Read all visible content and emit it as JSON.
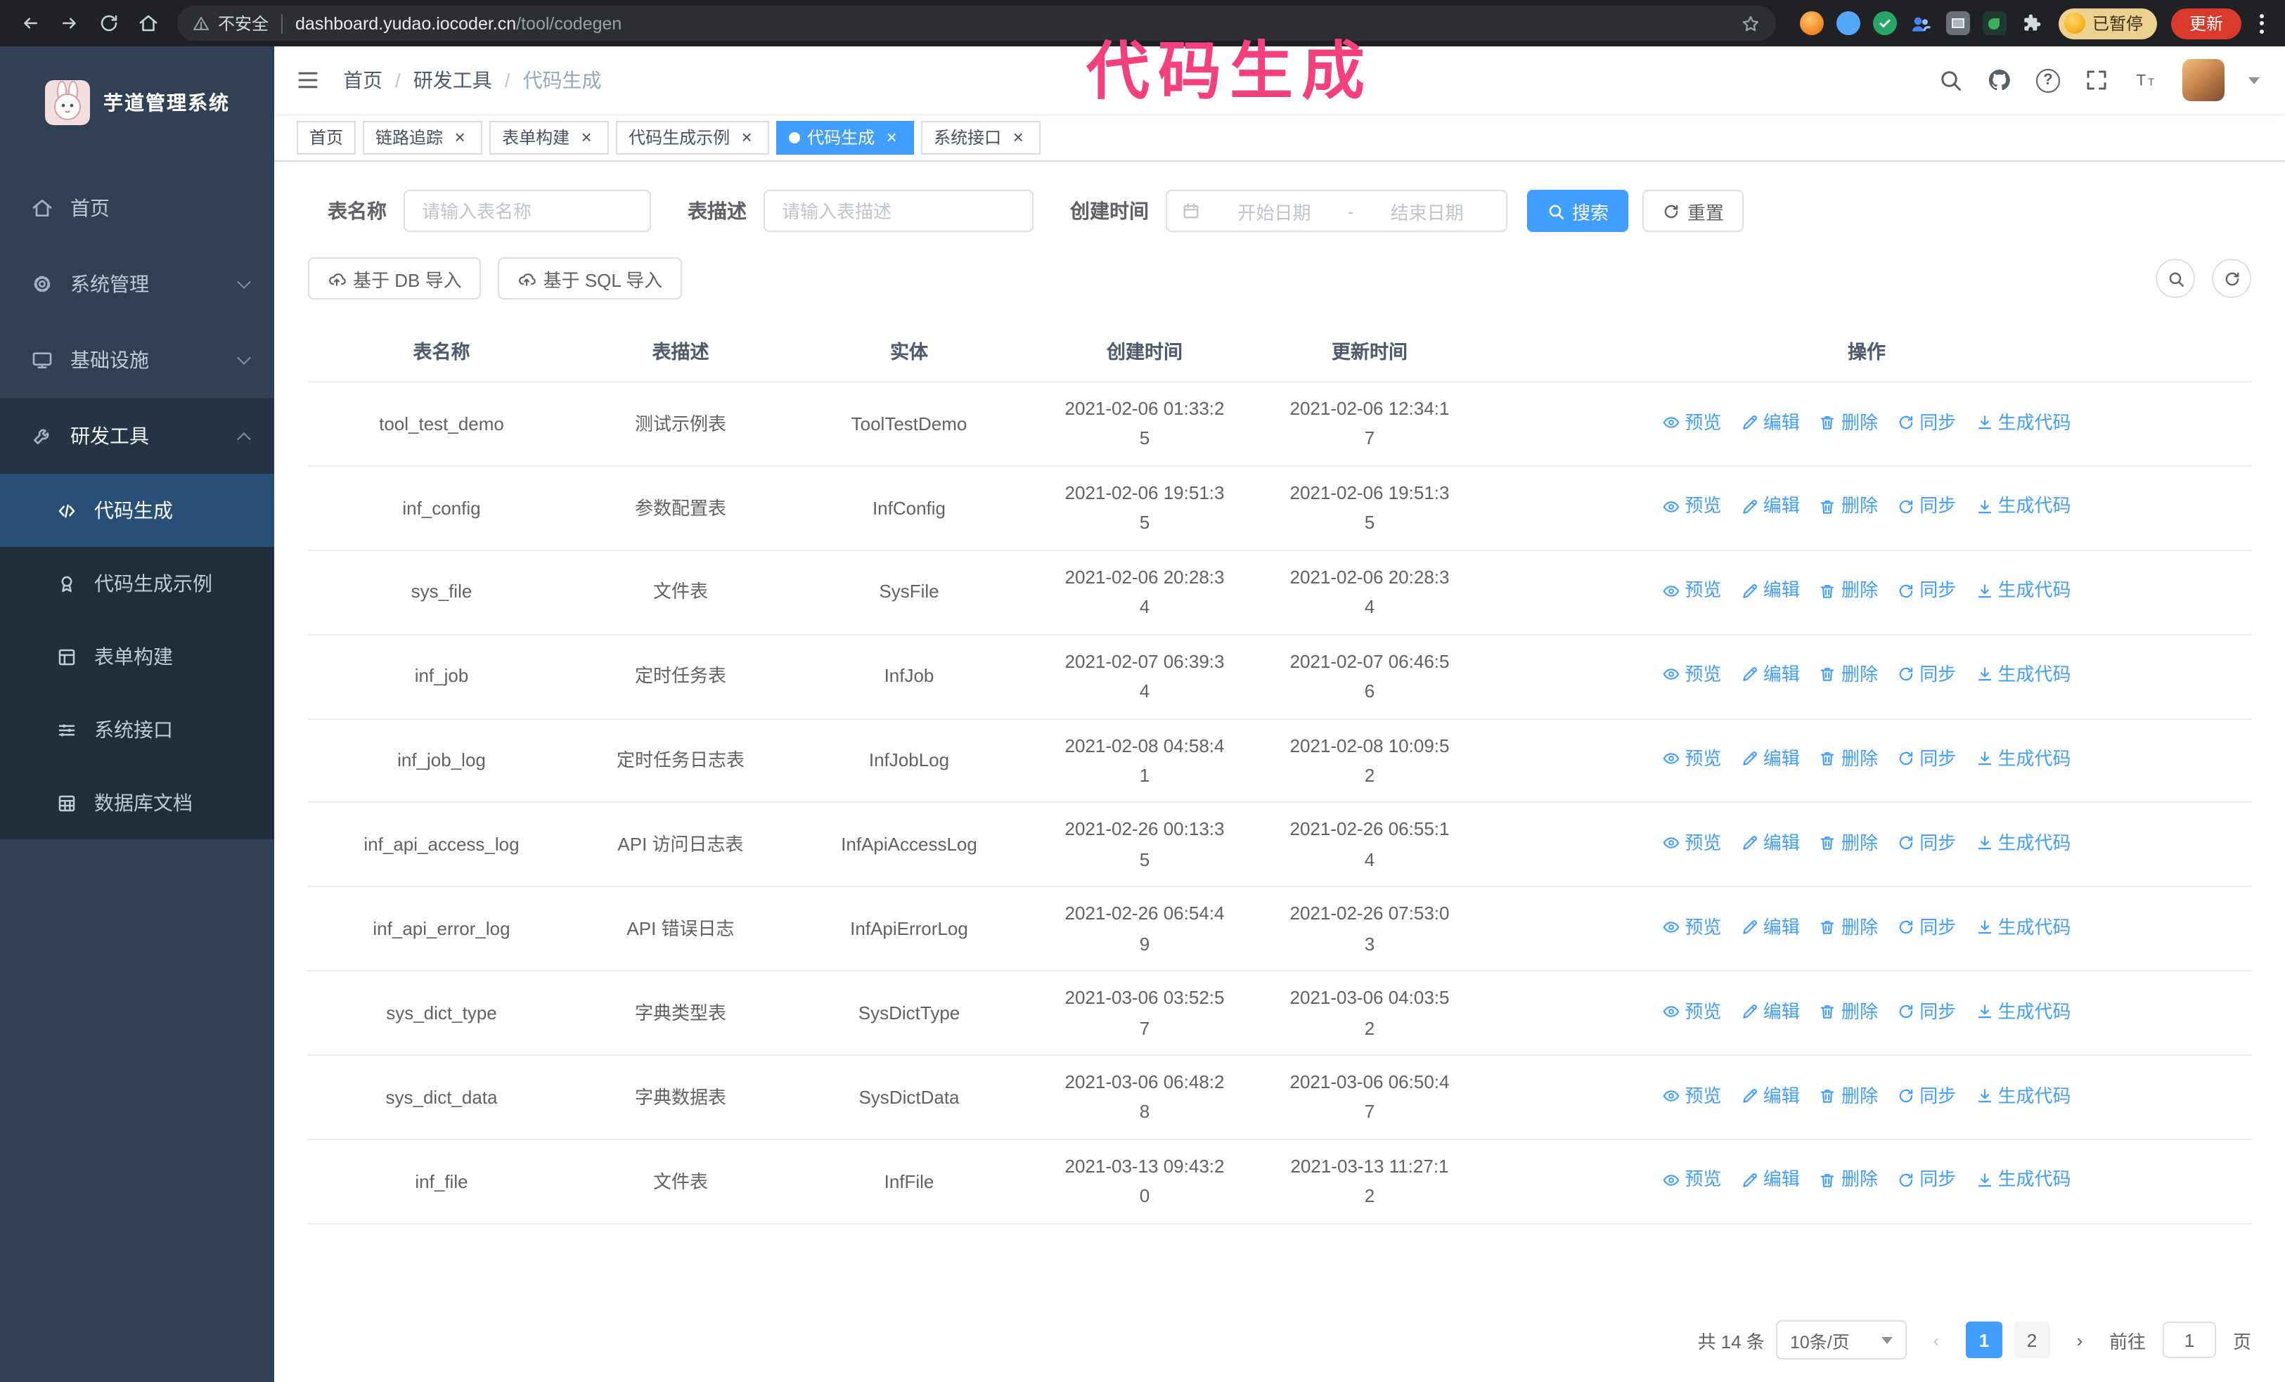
{
  "browser": {
    "security_label": "不安全",
    "url_host": "dashboard.yudao.iocoder.cn",
    "url_path": "/tool/codegen",
    "paused_label": "已暂停",
    "update_label": "更新"
  },
  "annotation": {
    "text": "代码生成",
    "color": "#f4417d"
  },
  "icons": {
    "close": "×",
    "prev": "‹",
    "next": "›",
    "question": "?"
  },
  "sidebar": {
    "logo_title": "芋道管理系统",
    "items": [
      {
        "label": "首页"
      },
      {
        "label": "系统管理"
      },
      {
        "label": "基础设施"
      },
      {
        "label": "研发工具"
      }
    ],
    "submenu": [
      {
        "label": "代码生成",
        "active": true
      },
      {
        "label": "代码生成示例"
      },
      {
        "label": "表单构建"
      },
      {
        "label": "系统接口"
      },
      {
        "label": "数据库文档"
      }
    ]
  },
  "navbar": {
    "breadcrumb": [
      "首页",
      "研发工具",
      "代码生成"
    ],
    "breadcrumb_separator": "/"
  },
  "tabs": [
    {
      "label": "首页",
      "closable": false,
      "active": false
    },
    {
      "label": "链路追踪",
      "closable": true,
      "active": false
    },
    {
      "label": "表单构建",
      "closable": true,
      "active": false
    },
    {
      "label": "代码生成示例",
      "closable": true,
      "active": false
    },
    {
      "label": "代码生成",
      "closable": true,
      "active": true
    },
    {
      "label": "系统接口",
      "closable": true,
      "active": false
    }
  ],
  "filters": {
    "table_name_label": "表名称",
    "table_name_placeholder": "请输入表名称",
    "table_desc_label": "表描述",
    "table_desc_placeholder": "请输入表描述",
    "create_time_label": "创建时间",
    "start_date_placeholder": "开始日期",
    "range_separator": "-",
    "end_date_placeholder": "结束日期",
    "search_label": "搜索",
    "reset_label": "重置"
  },
  "toolbar": {
    "import_db_label": "基于 DB 导入",
    "import_sql_label": "基于 SQL 导入"
  },
  "table": {
    "columns": [
      "表名称",
      "表描述",
      "实体",
      "创建时间",
      "更新时间",
      "操作"
    ],
    "row_actions": [
      "预览",
      "编辑",
      "删除",
      "同步",
      "生成代码"
    ],
    "rows": [
      {
        "name": "tool_test_demo",
        "desc": "测试示例表",
        "entity": "ToolTestDemo",
        "created": "2021-02-06 01:33:25",
        "updated": "2021-02-06 12:34:17"
      },
      {
        "name": "inf_config",
        "desc": "参数配置表",
        "entity": "InfConfig",
        "created": "2021-02-06 19:51:35",
        "updated": "2021-02-06 19:51:35"
      },
      {
        "name": "sys_file",
        "desc": "文件表",
        "entity": "SysFile",
        "created": "2021-02-06 20:28:34",
        "updated": "2021-02-06 20:28:34"
      },
      {
        "name": "inf_job",
        "desc": "定时任务表",
        "entity": "InfJob",
        "created": "2021-02-07 06:39:34",
        "updated": "2021-02-07 06:46:56"
      },
      {
        "name": "inf_job_log",
        "desc": "定时任务日志表",
        "entity": "InfJobLog",
        "created": "2021-02-08 04:58:41",
        "updated": "2021-02-08 10:09:52"
      },
      {
        "name": "inf_api_access_log",
        "desc": "API 访问日志表",
        "entity": "InfApiAccessLog",
        "created": "2021-02-26 00:13:35",
        "updated": "2021-02-26 06:55:14"
      },
      {
        "name": "inf_api_error_log",
        "desc": "API 错误日志",
        "entity": "InfApiErrorLog",
        "created": "2021-02-26 06:54:49",
        "updated": "2021-02-26 07:53:03"
      },
      {
        "name": "sys_dict_type",
        "desc": "字典类型表",
        "entity": "SysDictType",
        "created": "2021-03-06 03:52:57",
        "updated": "2021-03-06 04:03:52"
      },
      {
        "name": "sys_dict_data",
        "desc": "字典数据表",
        "entity": "SysDictData",
        "created": "2021-03-06 06:48:28",
        "updated": "2021-03-06 06:50:47"
      },
      {
        "name": "inf_file",
        "desc": "文件表",
        "entity": "InfFile",
        "created": "2021-03-13 09:43:20",
        "updated": "2021-03-13 11:27:12"
      }
    ]
  },
  "pagination": {
    "total_label": "共 14 条",
    "page_size_label": "10条/页",
    "pages": [
      {
        "label": "1",
        "active": true
      },
      {
        "label": "2",
        "active": false
      }
    ],
    "goto_label": "前往",
    "goto_value": "1",
    "goto_suffix": "页"
  },
  "colors": {
    "accent": "#409eff",
    "sidebar_bg": "#304156",
    "submenu_bg": "#1f2d3d",
    "chrome_bg": "#202124",
    "update_button": "#d93a2b",
    "annotation": "#f4417d",
    "table_border": "#ebeef5"
  }
}
